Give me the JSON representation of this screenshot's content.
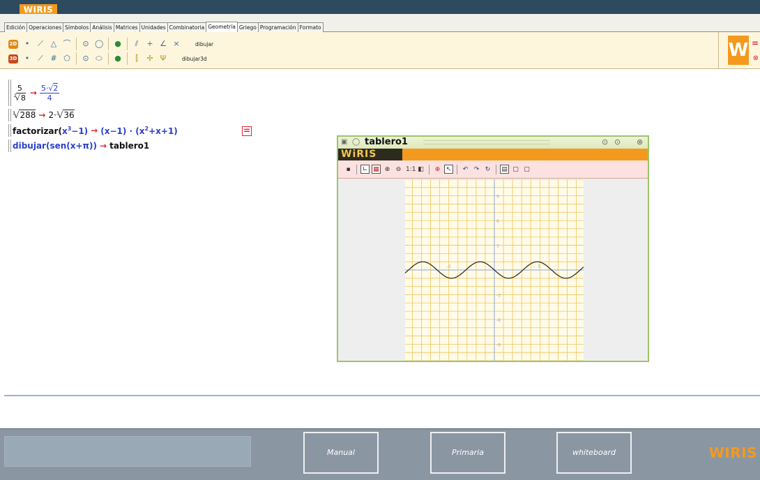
{
  "brand": {
    "logo_text": "WIRIS",
    "accent": "#f39a1e",
    "bar_color": "#2e4a5e"
  },
  "tabs": [
    {
      "label": "Edición"
    },
    {
      "label": "Operaciones"
    },
    {
      "label": "Símbolos"
    },
    {
      "label": "Análisis"
    },
    {
      "label": "Matrices"
    },
    {
      "label": "Unidades"
    },
    {
      "label": "Combinatoria"
    },
    {
      "label": "Geometría",
      "active": true
    },
    {
      "label": "Griego"
    },
    {
      "label": "Programación"
    },
    {
      "label": "Formato"
    }
  ],
  "toolbar": {
    "badge_2d": "2D",
    "badge_3d": "3D",
    "label_dibujar": "dibujar",
    "label_dibujar3d": "dibujar3d",
    "w_logo": "W",
    "side_equal": "=",
    "side_close": "⊗"
  },
  "worksheet": {
    "line1": {
      "num": "5",
      "root_index": "2",
      "radicand": "8",
      "res_num_coef": "5",
      "res_num_root": "2",
      "res_den": "4"
    },
    "line2": {
      "root_index": "3",
      "radicand": "288",
      "coef": "2",
      "res_root_index": "3",
      "res_radicand": "36"
    },
    "line3": {
      "func": "factorizar(",
      "base": "x",
      "exp": "3",
      "rest": "−1)",
      "res_a": "(x−1)",
      "dot": "·",
      "res_b_open": "(x",
      "res_b_exp": "2",
      "res_b_tail": "+x+1)"
    },
    "line4": {
      "input": "dibujar(sen(x+π))",
      "result": "tablero1"
    },
    "eq_button": "="
  },
  "tablero": {
    "title": "tablero1",
    "brand": "WiRIS",
    "tick_labels_y": [
      "9",
      "6",
      "3",
      "-3",
      "-6",
      "-9"
    ],
    "tick_labels_x": [
      "-5",
      "5"
    ],
    "plot": {
      "function": "sen(x+π)",
      "x_range": [
        -9.8,
        9.8
      ],
      "y_range": [
        -11,
        11
      ]
    }
  },
  "footer": {
    "buttons": [
      {
        "label": "Manual"
      },
      {
        "label": "Primaria"
      },
      {
        "label": "whiteboard"
      }
    ],
    "logo": "WIRIS"
  }
}
